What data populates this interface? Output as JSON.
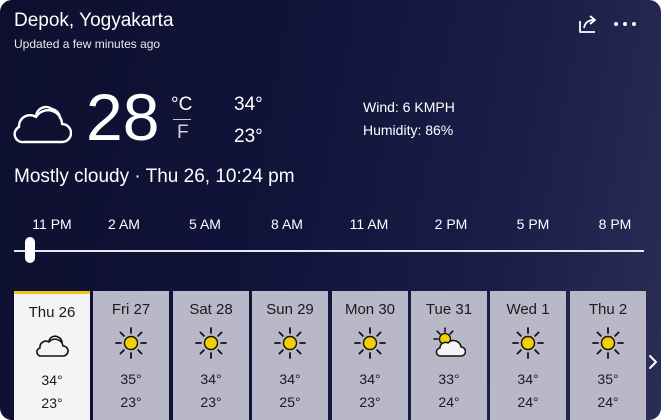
{
  "header": {
    "location": "Depok, Yogyakarta",
    "updated": "Updated a few minutes ago",
    "share_icon": "share-icon",
    "more_icon": "more-options-icon"
  },
  "current": {
    "icon": "cloud-icon",
    "temperature": "28",
    "unit_celsius": "°C",
    "unit_fahrenheit": "F",
    "high": "34°",
    "low": "23°",
    "wind": "Wind: 6 KMPH",
    "humidity": "Humidity: 86%",
    "condition": "Mostly cloudy · Thu 26, 10:24 pm"
  },
  "hourly": {
    "labels": [
      "11 PM",
      "2 AM",
      "5 AM",
      "8 AM",
      "11 AM",
      "2 PM",
      "5 PM",
      "8 PM"
    ],
    "slider_position": 0
  },
  "daily": [
    {
      "name": "Thu 26",
      "icon": "cloud-icon",
      "high": "34°",
      "low": "23°",
      "selected": true
    },
    {
      "name": "Fri 27",
      "icon": "sun-icon",
      "high": "35°",
      "low": "23°"
    },
    {
      "name": "Sat 28",
      "icon": "sun-icon",
      "high": "34°",
      "low": "23°"
    },
    {
      "name": "Sun 29",
      "icon": "sun-icon",
      "high": "34°",
      "low": "25°"
    },
    {
      "name": "Mon 30",
      "icon": "sun-icon",
      "high": "34°",
      "low": "23°"
    },
    {
      "name": "Tue 31",
      "icon": "partly-cloudy-icon",
      "high": "33°",
      "low": "24°"
    },
    {
      "name": "Wed 1",
      "icon": "sun-icon",
      "high": "34°",
      "low": "24°"
    },
    {
      "name": "Thu 2",
      "icon": "sun-icon",
      "high": "35°",
      "low": "24°"
    }
  ],
  "colors": {
    "accent": "#f2c417",
    "sun": "#f5d000"
  }
}
